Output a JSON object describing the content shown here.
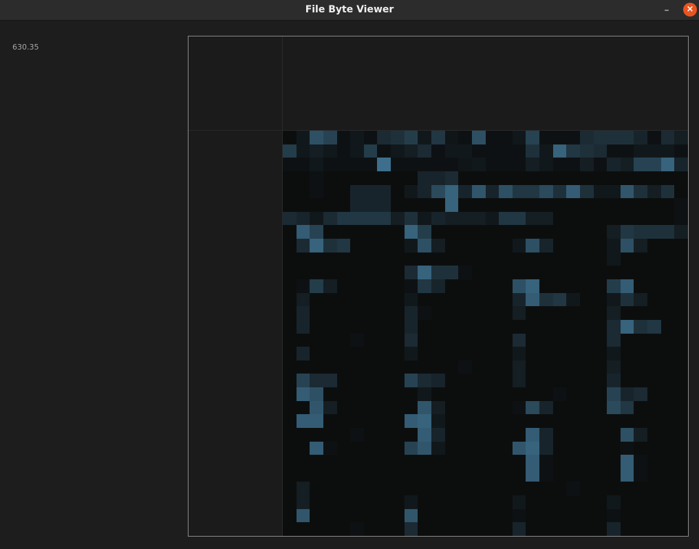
{
  "window": {
    "title": "File Byte Viewer",
    "minimize_glyph": "–",
    "close_glyph": "×"
  },
  "readout": {
    "value": "630.35"
  },
  "colors": {
    "cell_base": "#0b0b0b",
    "cell_accent": "#4a88ac",
    "close_button": "#e95420"
  },
  "byte_grid": {
    "cols": 30,
    "rows": 30,
    "levels": [
      [
        0.02,
        0.1,
        0.55,
        0.45,
        0.05,
        0.1,
        0.05,
        0.25,
        0.3,
        0.4,
        0.1,
        0.35,
        0.08,
        0.05,
        0.55,
        0.05,
        0.05,
        0.1,
        0.45,
        0.05,
        0.05,
        0.05,
        0.25,
        0.3,
        0.3,
        0.3,
        0.2,
        0.05,
        0.25,
        0.15
      ],
      [
        0.4,
        0.1,
        0.15,
        0.1,
        0.05,
        0.1,
        0.4,
        0.05,
        0.1,
        0.15,
        0.25,
        0.05,
        0.1,
        0.1,
        0.05,
        0.05,
        0.05,
        0.05,
        0.3,
        0.1,
        0.7,
        0.35,
        0.3,
        0.25,
        0.05,
        0.05,
        0.1,
        0.1,
        0.1,
        0.05
      ],
      [
        0.05,
        0.05,
        0.1,
        0.05,
        0.05,
        0.05,
        0.05,
        0.8,
        0.05,
        0.05,
        0.05,
        0.05,
        0.05,
        0.08,
        0.1,
        0.05,
        0.05,
        0.05,
        0.15,
        0.1,
        0.05,
        0.05,
        0.15,
        0.05,
        0.2,
        0.15,
        0.45,
        0.45,
        0.7,
        0.2
      ],
      [
        0.02,
        0.02,
        0.05,
        0.02,
        0.02,
        0.02,
        0.02,
        0.02,
        0.02,
        0.02,
        0.2,
        0.2,
        0.25,
        0.02,
        0.02,
        0.02,
        0.02,
        0.02,
        0.02,
        0.02,
        0.02,
        0.02,
        0.02,
        0.02,
        0.02,
        0.02,
        0.02,
        0.02,
        0.02,
        0.02
      ],
      [
        0.02,
        0.02,
        0.05,
        0.02,
        0.02,
        0.2,
        0.2,
        0.2,
        0.02,
        0.1,
        0.2,
        0.5,
        0.7,
        0.2,
        0.6,
        0.2,
        0.55,
        0.35,
        0.35,
        0.5,
        0.3,
        0.65,
        0.3,
        0.1,
        0.1,
        0.6,
        0.3,
        0.15,
        0.3,
        0.02
      ],
      [
        0.02,
        0.02,
        0.02,
        0.02,
        0.02,
        0.2,
        0.2,
        0.2,
        0.02,
        0.02,
        0.02,
        0.02,
        0.7,
        0.02,
        0.02,
        0.02,
        0.02,
        0.02,
        0.02,
        0.02,
        0.02,
        0.02,
        0.02,
        0.02,
        0.02,
        0.02,
        0.02,
        0.02,
        0.02,
        0.05
      ],
      [
        0.25,
        0.2,
        0.1,
        0.25,
        0.35,
        0.35,
        0.35,
        0.35,
        0.15,
        0.3,
        0.1,
        0.2,
        0.15,
        0.15,
        0.15,
        0.1,
        0.35,
        0.35,
        0.15,
        0.15,
        0.02,
        0.02,
        0.02,
        0.02,
        0.02,
        0.02,
        0.02,
        0.02,
        0.02,
        0.05
      ],
      [
        0.02,
        0.65,
        0.45,
        0.02,
        0.02,
        0.02,
        0.02,
        0.02,
        0.02,
        0.7,
        0.4,
        0.02,
        0.02,
        0.02,
        0.02,
        0.02,
        0.02,
        0.02,
        0.02,
        0.02,
        0.02,
        0.02,
        0.02,
        0.02,
        0.15,
        0.35,
        0.3,
        0.3,
        0.3,
        0.15
      ],
      [
        0.02,
        0.25,
        0.7,
        0.3,
        0.35,
        0.02,
        0.02,
        0.02,
        0.02,
        0.1,
        0.55,
        0.15,
        0.02,
        0.02,
        0.02,
        0.02,
        0.02,
        0.1,
        0.55,
        0.2,
        0.02,
        0.02,
        0.02,
        0.02,
        0.1,
        0.55,
        0.15,
        0.02,
        0.02,
        0.02
      ],
      [
        0.02,
        0.02,
        0.02,
        0.02,
        0.02,
        0.02,
        0.02,
        0.02,
        0.02,
        0.02,
        0.02,
        0.02,
        0.02,
        0.02,
        0.02,
        0.02,
        0.02,
        0.02,
        0.02,
        0.02,
        0.02,
        0.02,
        0.02,
        0.02,
        0.1,
        0.02,
        0.02,
        0.02,
        0.02,
        0.02
      ],
      [
        0.02,
        0.02,
        0.02,
        0.02,
        0.02,
        0.02,
        0.02,
        0.02,
        0.02,
        0.25,
        0.7,
        0.3,
        0.3,
        0.05,
        0.02,
        0.02,
        0.02,
        0.02,
        0.02,
        0.02,
        0.02,
        0.02,
        0.02,
        0.02,
        0.02,
        0.02,
        0.02,
        0.02,
        0.02,
        0.02
      ],
      [
        0.02,
        0.05,
        0.4,
        0.15,
        0.02,
        0.02,
        0.02,
        0.02,
        0.02,
        0.05,
        0.35,
        0.2,
        0.02,
        0.02,
        0.02,
        0.02,
        0.02,
        0.55,
        0.7,
        0.02,
        0.02,
        0.02,
        0.02,
        0.02,
        0.4,
        0.65,
        0.02,
        0.02,
        0.02,
        0.02
      ],
      [
        0.02,
        0.15,
        0.02,
        0.02,
        0.02,
        0.02,
        0.02,
        0.02,
        0.02,
        0.1,
        0.02,
        0.02,
        0.02,
        0.02,
        0.02,
        0.02,
        0.02,
        0.2,
        0.65,
        0.3,
        0.35,
        0.1,
        0.02,
        0.02,
        0.1,
        0.3,
        0.15,
        0.02,
        0.02,
        0.02
      ],
      [
        0.02,
        0.2,
        0.02,
        0.02,
        0.02,
        0.02,
        0.02,
        0.02,
        0.02,
        0.2,
        0.05,
        0.02,
        0.02,
        0.02,
        0.02,
        0.02,
        0.02,
        0.15,
        0.02,
        0.02,
        0.02,
        0.02,
        0.02,
        0.02,
        0.15,
        0.02,
        0.02,
        0.02,
        0.02,
        0.02
      ],
      [
        0.02,
        0.2,
        0.02,
        0.02,
        0.02,
        0.02,
        0.02,
        0.02,
        0.02,
        0.2,
        0.02,
        0.02,
        0.02,
        0.02,
        0.02,
        0.02,
        0.02,
        0.02,
        0.02,
        0.02,
        0.02,
        0.02,
        0.02,
        0.02,
        0.25,
        0.7,
        0.3,
        0.35,
        0.02,
        0.02
      ],
      [
        0.02,
        0.02,
        0.02,
        0.02,
        0.02,
        0.05,
        0.02,
        0.02,
        0.02,
        0.25,
        0.02,
        0.02,
        0.02,
        0.02,
        0.02,
        0.02,
        0.02,
        0.25,
        0.02,
        0.02,
        0.02,
        0.02,
        0.02,
        0.02,
        0.25,
        0.02,
        0.02,
        0.02,
        0.02,
        0.02
      ],
      [
        0.02,
        0.2,
        0.02,
        0.02,
        0.02,
        0.02,
        0.02,
        0.02,
        0.02,
        0.1,
        0.02,
        0.02,
        0.02,
        0.02,
        0.02,
        0.02,
        0.02,
        0.1,
        0.02,
        0.02,
        0.02,
        0.02,
        0.02,
        0.02,
        0.1,
        0.02,
        0.02,
        0.02,
        0.02,
        0.02
      ],
      [
        0.02,
        0.02,
        0.02,
        0.02,
        0.02,
        0.02,
        0.02,
        0.02,
        0.02,
        0.02,
        0.02,
        0.02,
        0.02,
        0.05,
        0.02,
        0.02,
        0.02,
        0.15,
        0.02,
        0.02,
        0.02,
        0.02,
        0.02,
        0.02,
        0.15,
        0.02,
        0.02,
        0.02,
        0.02,
        0.02
      ],
      [
        0.02,
        0.45,
        0.25,
        0.25,
        0.02,
        0.02,
        0.02,
        0.02,
        0.02,
        0.45,
        0.25,
        0.2,
        0.02,
        0.02,
        0.02,
        0.02,
        0.02,
        0.15,
        0.02,
        0.02,
        0.02,
        0.02,
        0.02,
        0.02,
        0.2,
        0.02,
        0.02,
        0.02,
        0.02,
        0.02
      ],
      [
        0.02,
        0.65,
        0.55,
        0.02,
        0.02,
        0.02,
        0.02,
        0.02,
        0.02,
        0.02,
        0.1,
        0.02,
        0.02,
        0.02,
        0.02,
        0.02,
        0.02,
        0.02,
        0.02,
        0.02,
        0.05,
        0.02,
        0.02,
        0.02,
        0.45,
        0.2,
        0.25,
        0.02,
        0.02,
        0.02
      ],
      [
        0.02,
        0.02,
        0.6,
        0.15,
        0.02,
        0.02,
        0.02,
        0.02,
        0.02,
        0.02,
        0.6,
        0.15,
        0.02,
        0.02,
        0.02,
        0.02,
        0.02,
        0.05,
        0.5,
        0.2,
        0.02,
        0.02,
        0.02,
        0.02,
        0.5,
        0.35,
        0.02,
        0.02,
        0.02,
        0.02
      ],
      [
        0.02,
        0.65,
        0.65,
        0.02,
        0.02,
        0.02,
        0.02,
        0.02,
        0.02,
        0.65,
        0.7,
        0.1,
        0.02,
        0.02,
        0.02,
        0.02,
        0.02,
        0.02,
        0.02,
        0.02,
        0.02,
        0.02,
        0.02,
        0.02,
        0.02,
        0.02,
        0.02,
        0.02,
        0.02,
        0.02
      ],
      [
        0.02,
        0.02,
        0.02,
        0.02,
        0.02,
        0.05,
        0.02,
        0.02,
        0.02,
        0.02,
        0.65,
        0.2,
        0.02,
        0.02,
        0.02,
        0.02,
        0.02,
        0.02,
        0.65,
        0.2,
        0.02,
        0.02,
        0.02,
        0.02,
        0.02,
        0.55,
        0.15,
        0.02,
        0.02,
        0.02
      ],
      [
        0.02,
        0.02,
        0.65,
        0.05,
        0.02,
        0.02,
        0.02,
        0.02,
        0.02,
        0.45,
        0.6,
        0.1,
        0.02,
        0.02,
        0.02,
        0.02,
        0.02,
        0.6,
        0.7,
        0.2,
        0.02,
        0.02,
        0.02,
        0.02,
        0.02,
        0.05,
        0.02,
        0.02,
        0.02,
        0.02
      ],
      [
        0.02,
        0.02,
        0.02,
        0.02,
        0.02,
        0.02,
        0.02,
        0.02,
        0.02,
        0.02,
        0.02,
        0.02,
        0.02,
        0.02,
        0.02,
        0.02,
        0.02,
        0.02,
        0.65,
        0.05,
        0.02,
        0.02,
        0.02,
        0.02,
        0.02,
        0.65,
        0.05,
        0.02,
        0.02,
        0.02
      ],
      [
        0.02,
        0.02,
        0.02,
        0.02,
        0.02,
        0.02,
        0.02,
        0.02,
        0.02,
        0.02,
        0.02,
        0.02,
        0.02,
        0.02,
        0.02,
        0.02,
        0.02,
        0.02,
        0.65,
        0.05,
        0.02,
        0.02,
        0.02,
        0.02,
        0.02,
        0.65,
        0.05,
        0.02,
        0.02,
        0.02
      ],
      [
        0.02,
        0.15,
        0.02,
        0.02,
        0.02,
        0.02,
        0.02,
        0.02,
        0.02,
        0.02,
        0.02,
        0.02,
        0.02,
        0.02,
        0.02,
        0.02,
        0.02,
        0.02,
        0.02,
        0.02,
        0.02,
        0.05,
        0.02,
        0.02,
        0.02,
        0.02,
        0.02,
        0.02,
        0.02,
        0.02
      ],
      [
        0.02,
        0.15,
        0.02,
        0.02,
        0.02,
        0.02,
        0.02,
        0.02,
        0.02,
        0.1,
        0.02,
        0.02,
        0.02,
        0.02,
        0.02,
        0.02,
        0.02,
        0.1,
        0.02,
        0.02,
        0.02,
        0.02,
        0.02,
        0.02,
        0.1,
        0.02,
        0.02,
        0.02,
        0.02,
        0.02
      ],
      [
        0.02,
        0.6,
        0.02,
        0.02,
        0.02,
        0.02,
        0.02,
        0.02,
        0.02,
        0.6,
        0.02,
        0.02,
        0.02,
        0.02,
        0.02,
        0.02,
        0.02,
        0.05,
        0.02,
        0.02,
        0.02,
        0.02,
        0.02,
        0.02,
        0.05,
        0.02,
        0.02,
        0.02,
        0.02,
        0.02
      ],
      [
        0.02,
        0.02,
        0.02,
        0.02,
        0.02,
        0.05,
        0.02,
        0.02,
        0.02,
        0.25,
        0.02,
        0.02,
        0.02,
        0.02,
        0.02,
        0.02,
        0.02,
        0.2,
        0.02,
        0.02,
        0.02,
        0.02,
        0.02,
        0.02,
        0.2,
        0.02,
        0.02,
        0.02,
        0.02,
        0.02
      ]
    ]
  }
}
